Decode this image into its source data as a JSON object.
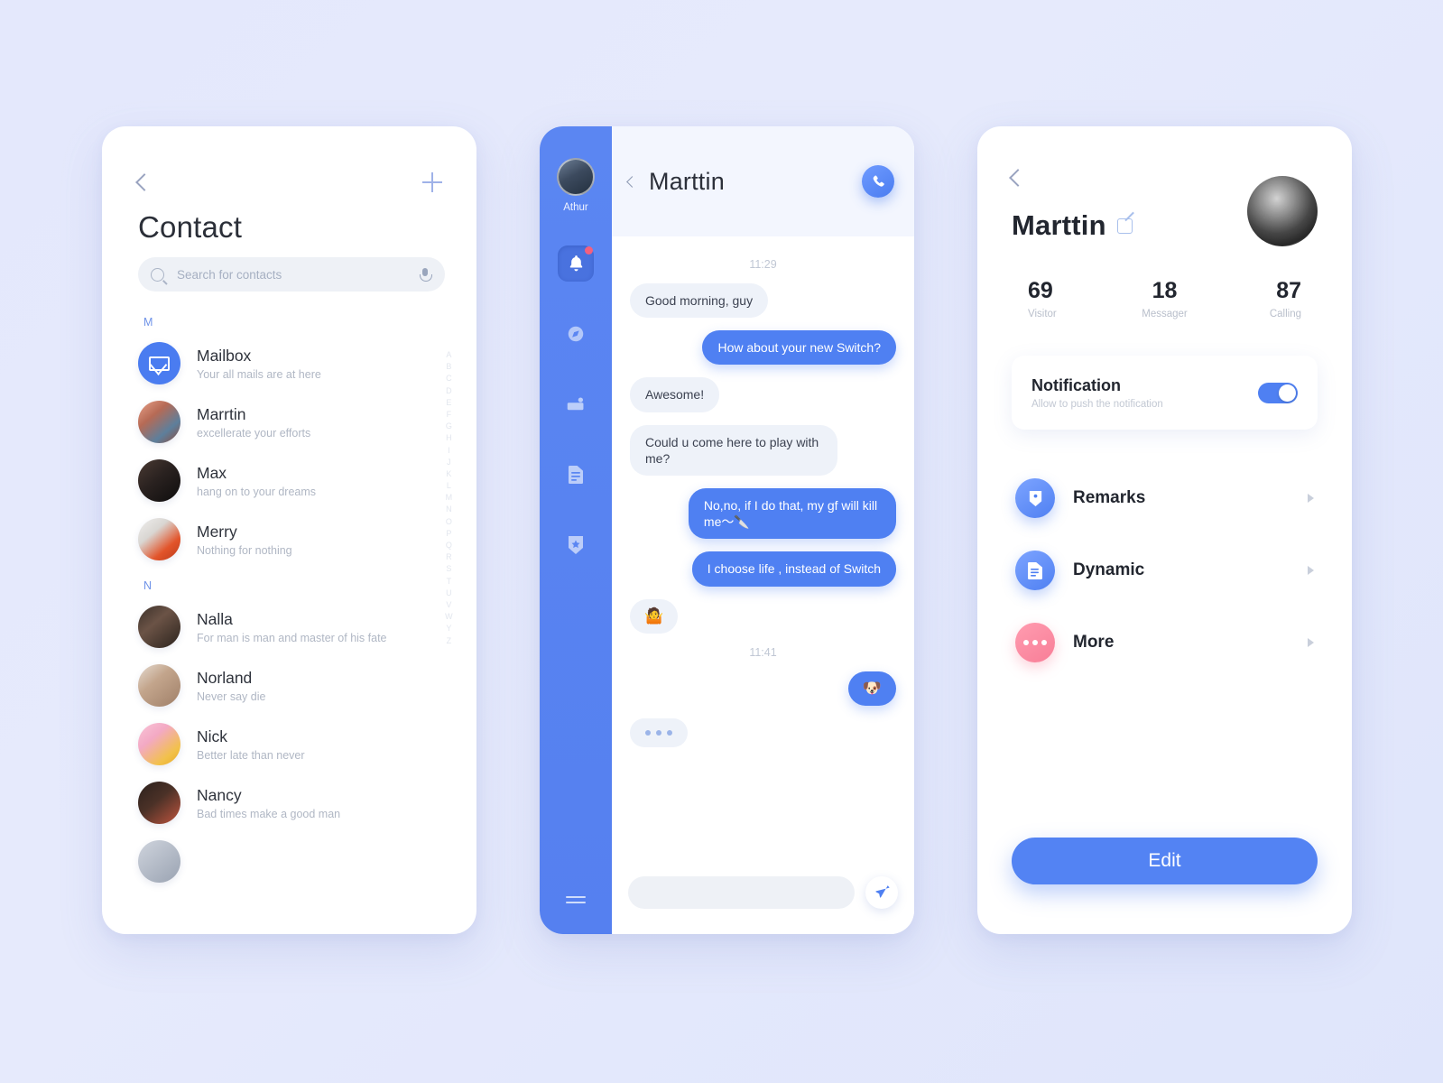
{
  "theme": {
    "accent": "#4f80f2",
    "accent_rail": "#5b86f2",
    "pink": "#f87e97",
    "page_background": "#e4e8fc",
    "bubble_them_bg": "#eef2f9",
    "bubble_me_bg": "#4f80f2"
  },
  "contacts_panel": {
    "back_icon": "chevron-left-icon",
    "add_icon": "plus-icon",
    "title": "Contact",
    "search": {
      "placeholder": "Search for contacts",
      "value": "",
      "search_icon": "search-icon",
      "mic_icon": "microphone-icon"
    },
    "sections": [
      {
        "letter": "M",
        "items": [
          {
            "name": "Mailbox",
            "subtitle": "Your all mails are at here",
            "icon": "mailbox-icon",
            "avatar_kind": "icon"
          },
          {
            "name": "Marrtin",
            "subtitle": "excellerate your efforts",
            "avatar_kind": "photo"
          },
          {
            "name": "Max",
            "subtitle": "hang on to your dreams",
            "avatar_kind": "photo"
          },
          {
            "name": "Merry",
            "subtitle": "Nothing for nothing",
            "avatar_kind": "photo"
          }
        ]
      },
      {
        "letter": "N",
        "items": [
          {
            "name": "Nalla",
            "subtitle": "For man is man and master of his fate",
            "avatar_kind": "photo"
          },
          {
            "name": "Norland",
            "subtitle": "Never say die",
            "avatar_kind": "photo"
          },
          {
            "name": "Nick",
            "subtitle": "Better late than never",
            "avatar_kind": "photo"
          },
          {
            "name": "Nancy",
            "subtitle": "Bad times make a good man",
            "avatar_kind": "photo"
          }
        ]
      }
    ],
    "alpha_index": [
      "A",
      "B",
      "C",
      "D",
      "E",
      "F",
      "G",
      "H",
      "I",
      "J",
      "K",
      "L",
      "M",
      "N",
      "O",
      "P",
      "Q",
      "R",
      "S",
      "T",
      "U",
      "V",
      "W",
      "Y",
      "Z"
    ]
  },
  "chat_panel": {
    "rail": {
      "user_name": "Athur",
      "user_avatar": "athur-avatar",
      "items": [
        {
          "icon": "bell-icon",
          "active": true,
          "badge": true
        },
        {
          "icon": "compass-icon",
          "active": false,
          "badge": false
        },
        {
          "icon": "camera-icon",
          "active": false,
          "badge": false
        },
        {
          "icon": "document-icon",
          "active": false,
          "badge": false
        },
        {
          "icon": "shield-star-icon",
          "active": false,
          "badge": false
        }
      ],
      "menu_icon": "hamburger-menu-icon"
    },
    "header": {
      "back_icon": "chevron-left-icon",
      "title": "Marttin",
      "call_icon": "phone-icon"
    },
    "messages": [
      {
        "type": "time",
        "text": "11:29"
      },
      {
        "type": "text",
        "from": "them",
        "text": "Good morning, guy"
      },
      {
        "type": "text",
        "from": "me",
        "text": "How about your new Switch?"
      },
      {
        "type": "text",
        "from": "them",
        "text": "Awesome!"
      },
      {
        "type": "text",
        "from": "them",
        "text": "Could u come here to play with me?"
      },
      {
        "type": "text",
        "from": "me",
        "text": "No,no, if I do that, my gf will kill me～🔪"
      },
      {
        "type": "text",
        "from": "me",
        "text": "I choose life , instead of Switch"
      },
      {
        "type": "emoji",
        "from": "them",
        "text": "🤷"
      },
      {
        "type": "time",
        "text": "11:41"
      },
      {
        "type": "emoji",
        "from": "me",
        "text": "🐶"
      },
      {
        "type": "typing",
        "from": "them",
        "text": ""
      }
    ],
    "input": {
      "placeholder": "",
      "value": "",
      "send_icon": "send-paper-plane-icon"
    }
  },
  "profile_panel": {
    "back_icon": "chevron-left-icon",
    "name": "Marttin",
    "edit_name_icon": "edit-pencil-icon",
    "avatar": "marttin-avatar",
    "stats": [
      {
        "value": "69",
        "label": "Visitor"
      },
      {
        "value": "18",
        "label": "Messager"
      },
      {
        "value": "87",
        "label": "Calling"
      }
    ],
    "notification": {
      "title": "Notification",
      "subtitle": "Allow to push the notification",
      "toggle_on": true
    },
    "menu": [
      {
        "label": "Remarks",
        "icon": "shield-dot-icon",
        "color": "blue"
      },
      {
        "label": "Dynamic",
        "icon": "document-icon",
        "color": "blue"
      },
      {
        "label": "More",
        "icon": "more-dots-icon",
        "color": "pink"
      }
    ],
    "edit_button": "Edit"
  }
}
